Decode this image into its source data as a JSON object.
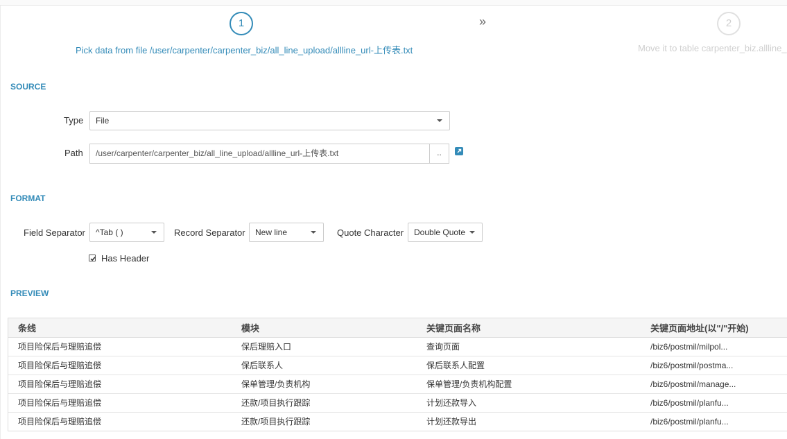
{
  "steps": [
    {
      "number": "1",
      "label": "Pick data from file /user/carpenter/carpenter_biz/all_line_upload/allline_url-上传表.txt",
      "active": true
    },
    {
      "number": "2",
      "label": "Move it to table carpenter_biz.allline_u",
      "active": false
    }
  ],
  "step_arrow": "»",
  "source": {
    "title": "SOURCE",
    "type_label": "Type",
    "type_value": "File",
    "path_label": "Path",
    "path_value": "/user/carpenter/carpenter_biz/all_line_upload/allline_url-上传表.txt",
    "path_button": ".."
  },
  "format": {
    "title": "FORMAT",
    "field_separator_label": "Field Separator",
    "field_separator_value": "^Tab ( )",
    "record_separator_label": "Record Separator",
    "record_separator_value": "New line",
    "quote_character_label": "Quote Character",
    "quote_character_value": "Double Quote",
    "has_header_label": "Has Header",
    "has_header_checked": true
  },
  "preview": {
    "title": "PREVIEW",
    "columns": [
      "条线",
      "模块",
      "关键页面名称",
      "关键页面地址(以\"/\"开始)"
    ],
    "rows": [
      [
        "项目险保后与理赔追偿",
        "保后理赔入口",
        "查询页面",
        "/biz6/postmil/milpol..."
      ],
      [
        "项目险保后与理赔追偿",
        "保后联系人",
        "保后联系人配置",
        "/biz6/postmil/postma..."
      ],
      [
        "项目险保后与理赔追偿",
        "保单管理/负责机构",
        "保单管理/负责机构配置",
        "/biz6/postmil/manage..."
      ],
      [
        "项目险保后与理赔追偿",
        "还款/项目执行跟踪",
        "计划还款导入",
        "/biz6/postmil/planfu..."
      ],
      [
        "项目险保后与理赔追偿",
        "还款/项目执行跟踪",
        "计划还款导出",
        "/biz6/postmil/planfu..."
      ]
    ]
  },
  "colors": {
    "accent": "#338bb8",
    "inactive": "#cfcfcf"
  }
}
